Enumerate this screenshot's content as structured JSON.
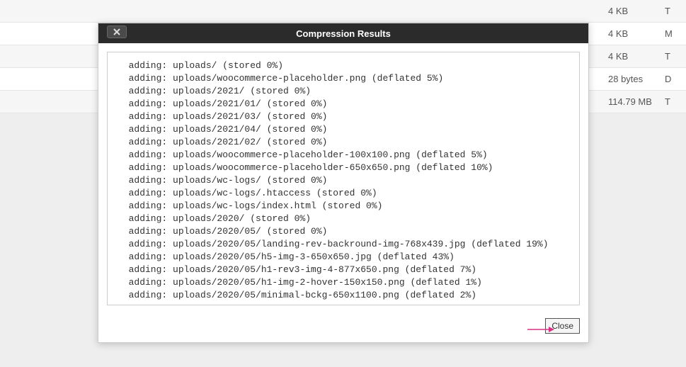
{
  "dialog": {
    "title": "Compression Results",
    "close_button": "Close",
    "log_lines": [
      "  adding: uploads/ (stored 0%)",
      "  adding: uploads/woocommerce-placeholder.png (deflated 5%)",
      "  adding: uploads/2021/ (stored 0%)",
      "  adding: uploads/2021/01/ (stored 0%)",
      "  adding: uploads/2021/03/ (stored 0%)",
      "  adding: uploads/2021/04/ (stored 0%)",
      "  adding: uploads/2021/02/ (stored 0%)",
      "  adding: uploads/woocommerce-placeholder-100x100.png (deflated 5%)",
      "  adding: uploads/woocommerce-placeholder-650x650.png (deflated 10%)",
      "  adding: uploads/wc-logs/ (stored 0%)",
      "  adding: uploads/wc-logs/.htaccess (stored 0%)",
      "  adding: uploads/wc-logs/index.html (stored 0%)",
      "  adding: uploads/2020/ (stored 0%)",
      "  adding: uploads/2020/05/ (stored 0%)",
      "  adding: uploads/2020/05/landing-rev-backround-img-768x439.jpg (deflated 19%)",
      "  adding: uploads/2020/05/h5-img-3-650x650.jpg (deflated 43%)",
      "  adding: uploads/2020/05/h1-rev3-img-4-877x650.png (deflated 7%)",
      "  adding: uploads/2020/05/h1-img-2-hover-150x150.png (deflated 1%)",
      "  adding: uploads/2020/05/minimal-bckg-650x1100.png (deflated 2%)"
    ]
  },
  "bg_rows": [
    {
      "size": "4 KB",
      "type": "T"
    },
    {
      "size": "4 KB",
      "type": "M"
    },
    {
      "size": "4 KB",
      "type": "T"
    },
    {
      "size": "28 bytes",
      "type": "D"
    },
    {
      "size": "114.79 MB",
      "type": "T"
    }
  ]
}
